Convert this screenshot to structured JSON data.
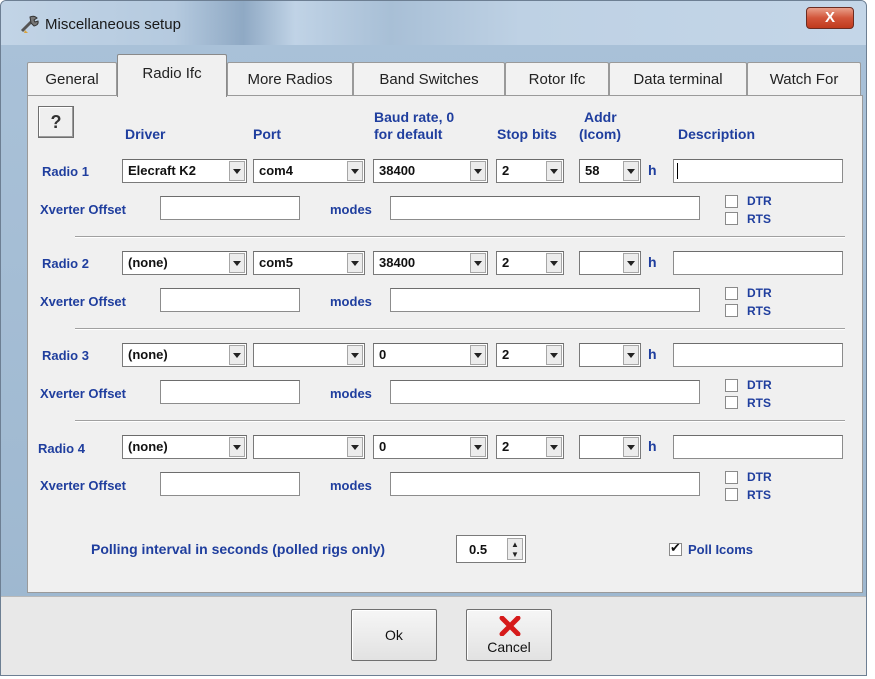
{
  "window": {
    "title": "Miscellaneous setup",
    "close_label": "X"
  },
  "tabs": [
    {
      "label": "General"
    },
    {
      "label": "Radio Ifc"
    },
    {
      "label": "More Radios"
    },
    {
      "label": "Band Switches"
    },
    {
      "label": "Rotor Ifc"
    },
    {
      "label": "Data terminal"
    },
    {
      "label": "Watch For"
    }
  ],
  "help_button": {
    "icon": "question-mark-icon",
    "label": "?"
  },
  "headers": {
    "driver": "Driver",
    "port": "Port",
    "baud_line1": "Baud rate, 0",
    "baud_line2": "for default",
    "stop_bits": "Stop bits",
    "addr_line1": "Addr",
    "addr_line2": "(Icom)",
    "description": "Description"
  },
  "radios": [
    {
      "label": "Radio 1",
      "driver": "Elecraft K2",
      "port": "com4",
      "baud": "38400",
      "stop": "2",
      "addr": "58",
      "h": "h",
      "description": "",
      "xverter_label": "Xverter Offset",
      "xverter_value": "",
      "modes_label": "modes",
      "modes_value": "",
      "dtr": "DTR",
      "rts": "RTS"
    },
    {
      "label": "Radio 2",
      "driver": "(none)",
      "port": "com5",
      "baud": "38400",
      "stop": "2",
      "addr": "",
      "h": "h",
      "description": "",
      "xverter_label": "Xverter Offset",
      "xverter_value": "",
      "modes_label": "modes",
      "modes_value": "",
      "dtr": "DTR",
      "rts": "RTS"
    },
    {
      "label": "Radio 3",
      "driver": "(none)",
      "port": "",
      "baud": "0",
      "stop": "2",
      "addr": "",
      "h": "h",
      "description": "",
      "xverter_label": "Xverter Offset",
      "xverter_value": "",
      "modes_label": "modes",
      "modes_value": "",
      "dtr": "DTR",
      "rts": "RTS"
    },
    {
      "label": "Radio 4",
      "driver": "(none)",
      "port": "",
      "baud": "0",
      "stop": "2",
      "addr": "",
      "h": "h",
      "description": "",
      "xverter_label": "Xverter Offset",
      "xverter_value": "",
      "modes_label": "modes",
      "modes_value": "",
      "dtr": "DTR",
      "rts": "RTS"
    }
  ],
  "polling": {
    "label": "Polling interval in seconds (polled rigs only)",
    "value": "0.5"
  },
  "poll_icoms": {
    "label": "Poll Icoms",
    "checked": true
  },
  "buttons": {
    "ok": "Ok",
    "cancel": "Cancel"
  },
  "colors": {
    "label_blue": "#1f3e9e",
    "cancel_x": "#d61a1a"
  }
}
